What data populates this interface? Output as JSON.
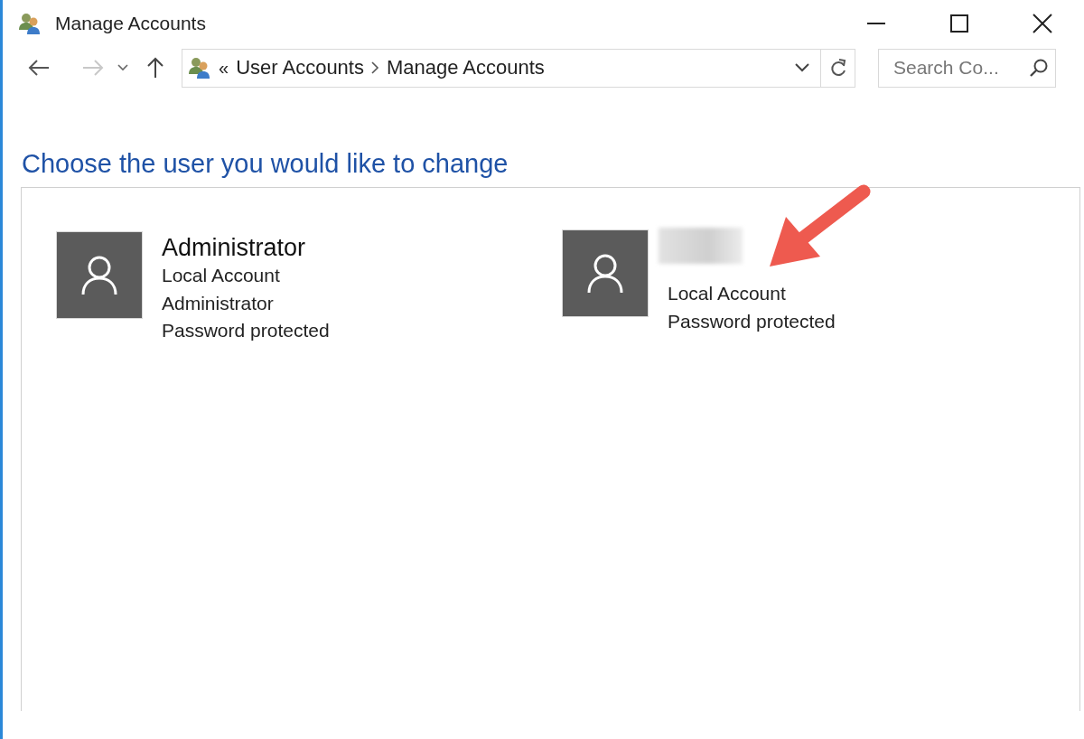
{
  "window": {
    "title": "Manage Accounts"
  },
  "address": {
    "overflow_mark": "«",
    "segments": [
      "User Accounts",
      "Manage Accounts"
    ]
  },
  "search": {
    "placeholder": "Search Co..."
  },
  "heading": "Choose the user you would like to change",
  "accounts": [
    {
      "name": "Administrator",
      "name_blurred": false,
      "highlighted": false,
      "details": [
        "Local Account",
        "Administrator",
        "Password protected"
      ]
    },
    {
      "name_blurred": true,
      "highlighted": true,
      "details": [
        "Local Account",
        "Password protected"
      ]
    }
  ]
}
